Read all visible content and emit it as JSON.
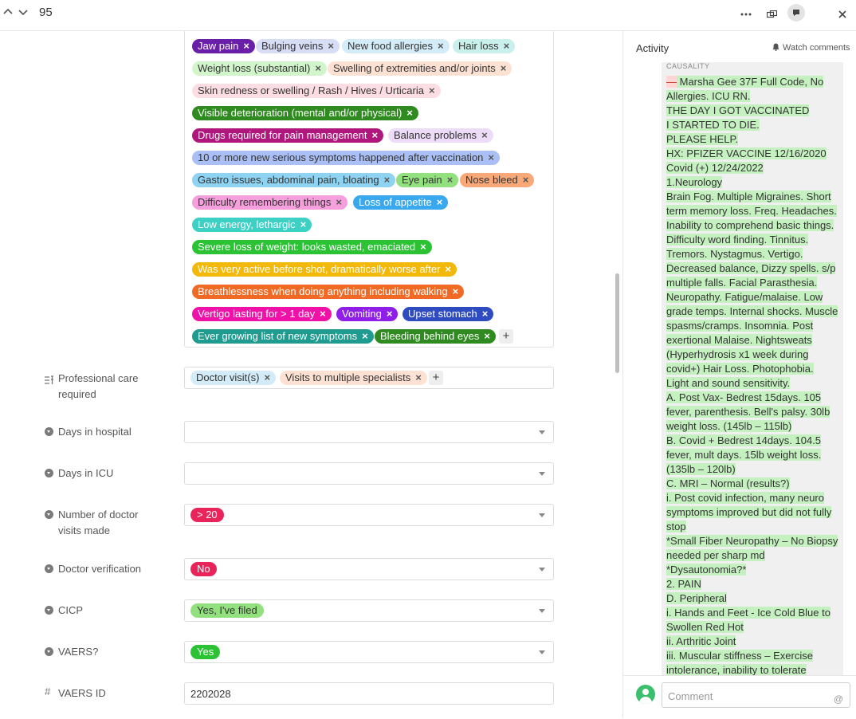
{
  "header": {
    "record_number": "95",
    "icons": [
      "chevron-up-icon",
      "chevron-down-icon",
      "more-icon",
      "expand-icon",
      "comment-icon",
      "close-icon"
    ]
  },
  "symptoms": {
    "tags": [
      {
        "label": "Jaw pain",
        "bg": "#6a1fa8",
        "fg": "#ffffff"
      },
      {
        "label": "Bulging veins",
        "bg": "#d6ddf5",
        "fg": "#333333"
      },
      {
        "label": "New food allergies",
        "bg": "#d4ebf8",
        "fg": "#333333"
      },
      {
        "label": "Hair loss",
        "bg": "#c9f0ea",
        "fg": "#333333"
      },
      {
        "label": "Weight loss (substantial)",
        "bg": "#d3f5cc",
        "fg": "#333333"
      },
      {
        "label": "Swelling of extremities and/or joints",
        "bg": "#fde2d3",
        "fg": "#333333"
      },
      {
        "label": "Skin redness or swelling / Rash / Hives / Urticaria",
        "bg": "#fbdde3",
        "fg": "#333333"
      },
      {
        "label": "Visible deterioration (mental and/or physical)",
        "bg": "#2f8a1f",
        "fg": "#ffffff"
      },
      {
        "label": "Drugs required for pain management",
        "bg": "#b0177d",
        "fg": "#ffffff"
      },
      {
        "label": "Balance problems",
        "bg": "#ecdcf7",
        "fg": "#333333"
      },
      {
        "label": "10 or more new serious symptoms happened after vaccination",
        "bg": "#aabff5",
        "fg": "#333333"
      },
      {
        "label": "Gastro issues, abdominal pain, bloating",
        "bg": "#8ed4f2",
        "fg": "#333333"
      },
      {
        "label": "Eye pain",
        "bg": "#92e07e",
        "fg": "#333333"
      },
      {
        "label": "Nose bleed",
        "bg": "#f9a878",
        "fg": "#333333"
      },
      {
        "label": "Difficulty remembering things",
        "bg": "#f5a0dc",
        "fg": "#333333"
      },
      {
        "label": "Loss of appetite",
        "bg": "#3aa8ee",
        "fg": "#ffffff"
      },
      {
        "label": "Low energy, lethargic",
        "bg": "#3dd0c4",
        "fg": "#ffffff"
      },
      {
        "label": "Severe loss of weight: looks wasted, emaciated",
        "bg": "#2bc234",
        "fg": "#ffffff"
      },
      {
        "label": "Was very active before shot, dramatically worse after",
        "bg": "#f2b80a",
        "fg": "#ffffff"
      },
      {
        "label": "Breathlessness when doing anything including walking",
        "bg": "#f06a25",
        "fg": "#ffffff"
      },
      {
        "label": "Vertigo lasting for > 1 day",
        "bg": "#f012a8",
        "fg": "#ffffff"
      },
      {
        "label": "Vomiting",
        "bg": "#8f1fe8",
        "fg": "#ffffff"
      },
      {
        "label": "Upset stomach",
        "bg": "#2f4bc0",
        "fg": "#ffffff"
      },
      {
        "label": "Ever growing list of new symptoms",
        "bg": "#1f9b8f",
        "fg": "#ffffff"
      },
      {
        "label": "Bleeding behind eyes",
        "bg": "#2f8a1f",
        "fg": "#ffffff"
      }
    ]
  },
  "professional_care": {
    "label_line1": "Professional care",
    "label_line2": "required",
    "tags": [
      {
        "label": "Doctor visit(s)",
        "bg": "#d4ebf8",
        "fg": "#333333"
      },
      {
        "label": "Visits to multiple specialists",
        "bg": "#fde2d3",
        "fg": "#333333"
      }
    ]
  },
  "fields": {
    "days_hospital": {
      "label": "Days in hospital",
      "value": ""
    },
    "days_icu": {
      "label": "Days in ICU",
      "value": ""
    },
    "doctor_visits": {
      "label_line1": "Number of doctor",
      "label_line2": "visits made",
      "value": "> 20",
      "bg": "#e8245a",
      "fg": "#ffffff"
    },
    "doctor_verification": {
      "label": "Doctor verification",
      "value": "No",
      "bg": "#e8245a",
      "fg": "#ffffff"
    },
    "cicp": {
      "label": "CICP",
      "value": "Yes, I've filed",
      "bg": "#92e07e",
      "fg": "#333333"
    },
    "vaers": {
      "label": "VAERS?",
      "value": "Yes",
      "bg": "#2bc234",
      "fg": "#ffffff"
    },
    "vaers_id": {
      "label": "VAERS ID",
      "value": "2202028"
    }
  },
  "activity": {
    "title": "Activity",
    "watch_label": "Watch comments",
    "caption": "CAUSALITY",
    "comment_placeholder": "Comment",
    "lines": [
      "— Marsha Gee 37F Full Code, No",
      "Allergies. ICU RN.",
      "THE DAY I GOT VACCINATED",
      "I STARTED TO DIE.",
      "PLEASE HELP.",
      "HX: PFIZER VACCINE 12/16/2020",
      "Covid (+) 12/24/2022",
      "1.Neurology",
      "Brain Fog. Multiple Migraines. Short",
      "term memory loss. Freq. Headaches.",
      "Inability to comprehend basic things.",
      "Difficulty word finding. Tinnitus.",
      "Tremors. Nystagmus. Vertigo.",
      "Decreased balance, Dizzy spells. s/p",
      "multiple falls. Facial Parasthesia.",
      "Neuropathy. Fatigue/malaise. Low",
      "grade temps. Internal shocks. Muscle",
      "spasms/cramps. Insomnia. Post",
      "exertional Malaise. Nightsweats",
      "(Hyperhydrosis x1 week during",
      "covid+) Hair Loss. Photophobia.",
      "Light and sound sensitivity.",
      "A. Post Vax- Bedrest 15days. 105",
      "fever, parenthesis. Bell's palsy. 30lb",
      "weight loss.  (145lb – 115lb)",
      "B. Covid + Bedrest 14days. 104.5",
      "fever, mult days. 15lb weight loss.",
      "(135lb – 120lb)",
      "C. MRI – Normal (results?)",
      "i. Post covid infection, many neuro",
      "symptoms improved but did not fully",
      "stop",
      "*Small Fiber Neuropathy – No Biopsy",
      "needed per sharp md",
      "*Dysautonomia?*",
      "2. PAIN",
      "D. Peripheral",
      "i. Hands and Feet - Ice Cold Blue to",
      "Swollen Red Hot",
      "ii. Arthritic Joint",
      "iii. Muscular stiffness – Exercise",
      "intolerance, inability to tolerate"
    ]
  }
}
